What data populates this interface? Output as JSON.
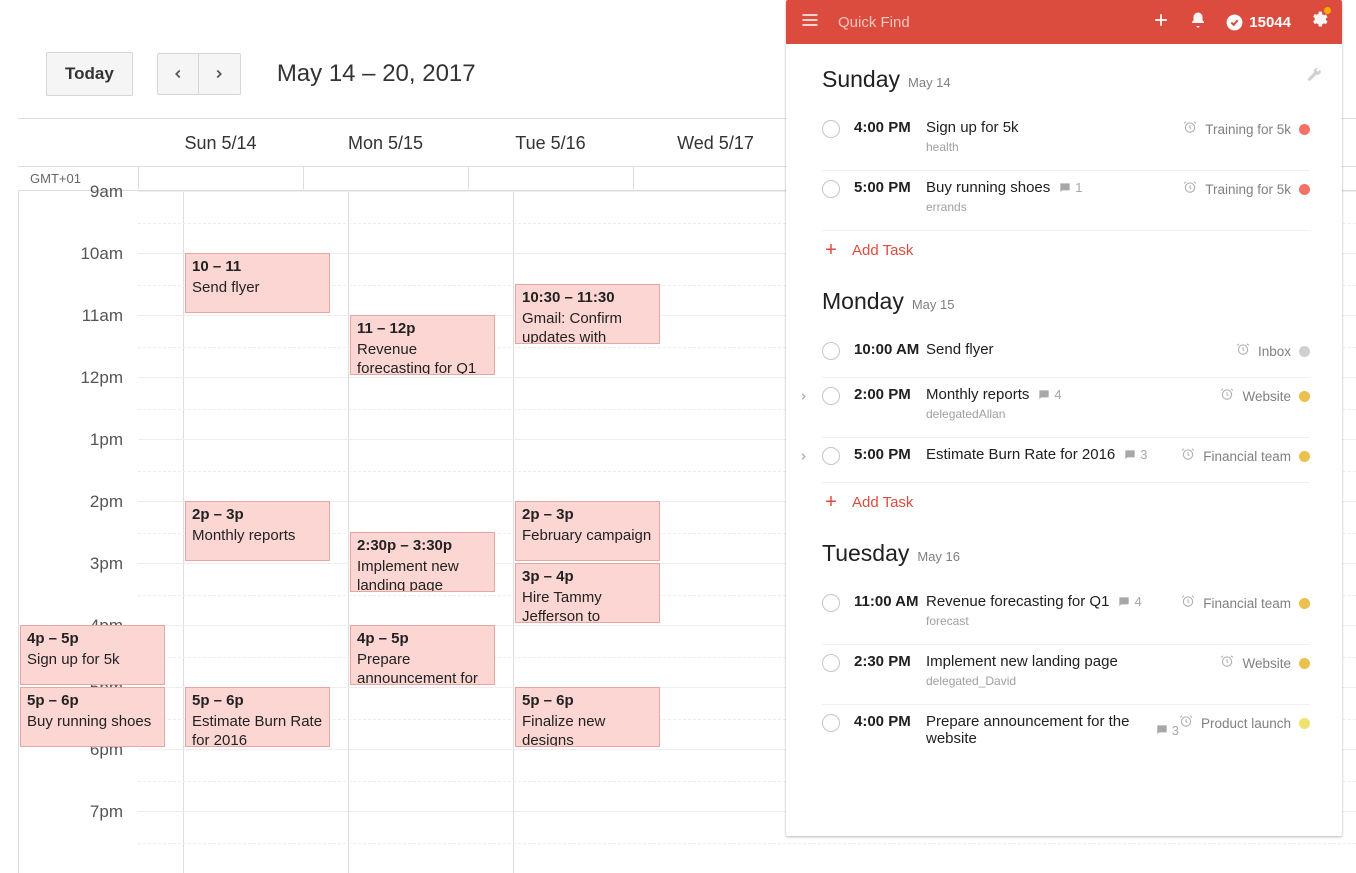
{
  "calendar": {
    "today_label": "Today",
    "date_range": "May 14 – 20, 2017",
    "timezone": "GMT+01",
    "day_columns": [
      "Sun 5/14",
      "Mon 5/15",
      "Tue 5/16",
      "Wed 5/17"
    ],
    "hours": [
      "9am",
      "10am",
      "11am",
      "12pm",
      "1pm",
      "2pm",
      "3pm",
      "4pm",
      "5pm",
      "6pm",
      "7pm"
    ],
    "now_hour_index": 2,
    "events": [
      {
        "col": 1,
        "start": 10,
        "end": 11,
        "time": "10 – 11",
        "title": "Send flyer"
      },
      {
        "col": 2,
        "start": 11,
        "end": 12,
        "time": "11 – 12p",
        "title": "Revenue forecasting for Q1"
      },
      {
        "col": 3,
        "start": 10.5,
        "end": 11.5,
        "time": "10:30 – 11:30",
        "title": "Gmail: Confirm updates with"
      },
      {
        "col": 1,
        "start": 14,
        "end": 15,
        "time": "2p – 3p",
        "title": "Monthly reports"
      },
      {
        "col": 2,
        "start": 14.5,
        "end": 15.5,
        "time": "2:30p – 3:30p",
        "title": "Implement new landing page"
      },
      {
        "col": 3,
        "start": 14,
        "end": 15,
        "time": "2p – 3p",
        "title": "February campaign"
      },
      {
        "col": 3,
        "start": 15,
        "end": 16,
        "time": "3p – 4p",
        "title": "Hire Tammy Jefferson to"
      },
      {
        "col": 0,
        "start": 16,
        "end": 17,
        "time": "4p – 5p",
        "title": "Sign up for 5k"
      },
      {
        "col": 2,
        "start": 16,
        "end": 17,
        "time": "4p – 5p",
        "title": "Prepare announcement for"
      },
      {
        "col": 0,
        "start": 17,
        "end": 18,
        "time": "5p – 6p",
        "title": "Buy running shoes"
      },
      {
        "col": 1,
        "start": 17,
        "end": 18,
        "time": "5p – 6p",
        "title": "Estimate Burn Rate for 2016"
      },
      {
        "col": 3,
        "start": 17,
        "end": 18,
        "time": "5p – 6p",
        "title": "Finalize new designs"
      }
    ]
  },
  "panel": {
    "quick_find": "Quick Find",
    "karma": "15044",
    "add_task_label": "Add Task",
    "days": [
      {
        "name": "Sunday",
        "date": "May 14",
        "tasks": [
          {
            "time": "4:00 PM",
            "title": "Sign up for 5k",
            "sub": "health",
            "reminder": true,
            "project": "Training for 5k",
            "color": "#f57066"
          },
          {
            "time": "5:00 PM",
            "title": "Buy running shoes",
            "sub": "errands",
            "comments": 1,
            "reminder": true,
            "project": "Training for 5k",
            "color": "#f57066"
          }
        ],
        "show_add": true
      },
      {
        "name": "Monday",
        "date": "May 15",
        "tasks": [
          {
            "time": "10:00 AM",
            "title": "Send flyer",
            "reminder": true,
            "project": "Inbox",
            "color": "#cfcfcf"
          },
          {
            "time": "2:00 PM",
            "title": "Monthly reports",
            "sub": "delegatedAllan",
            "comments": 4,
            "reminder": true,
            "project": "Website",
            "color": "#ecc04d",
            "expand": true
          },
          {
            "time": "5:00 PM",
            "title": "Estimate Burn Rate for 2016",
            "comments": 3,
            "reminder": true,
            "project": "Financial team",
            "color": "#ecc04d",
            "expand": true
          }
        ],
        "show_add": true
      },
      {
        "name": "Tuesday",
        "date": "May 16",
        "tasks": [
          {
            "time": "11:00 AM",
            "title": "Revenue forecasting for Q1",
            "sub": "forecast",
            "comments": 4,
            "reminder": true,
            "project": "Financial team",
            "color": "#ecc04d"
          },
          {
            "time": "2:30 PM",
            "title": "Implement new landing page",
            "sub": "delegated_David",
            "reminder": true,
            "project": "Website",
            "color": "#ecc04d"
          },
          {
            "time": "4:00 PM",
            "title": "Prepare announcement for the website",
            "comments": 3,
            "reminder": true,
            "project": "Product launch",
            "color": "#ede36c",
            "inline_comments": true
          }
        ],
        "show_add": false
      }
    ]
  }
}
